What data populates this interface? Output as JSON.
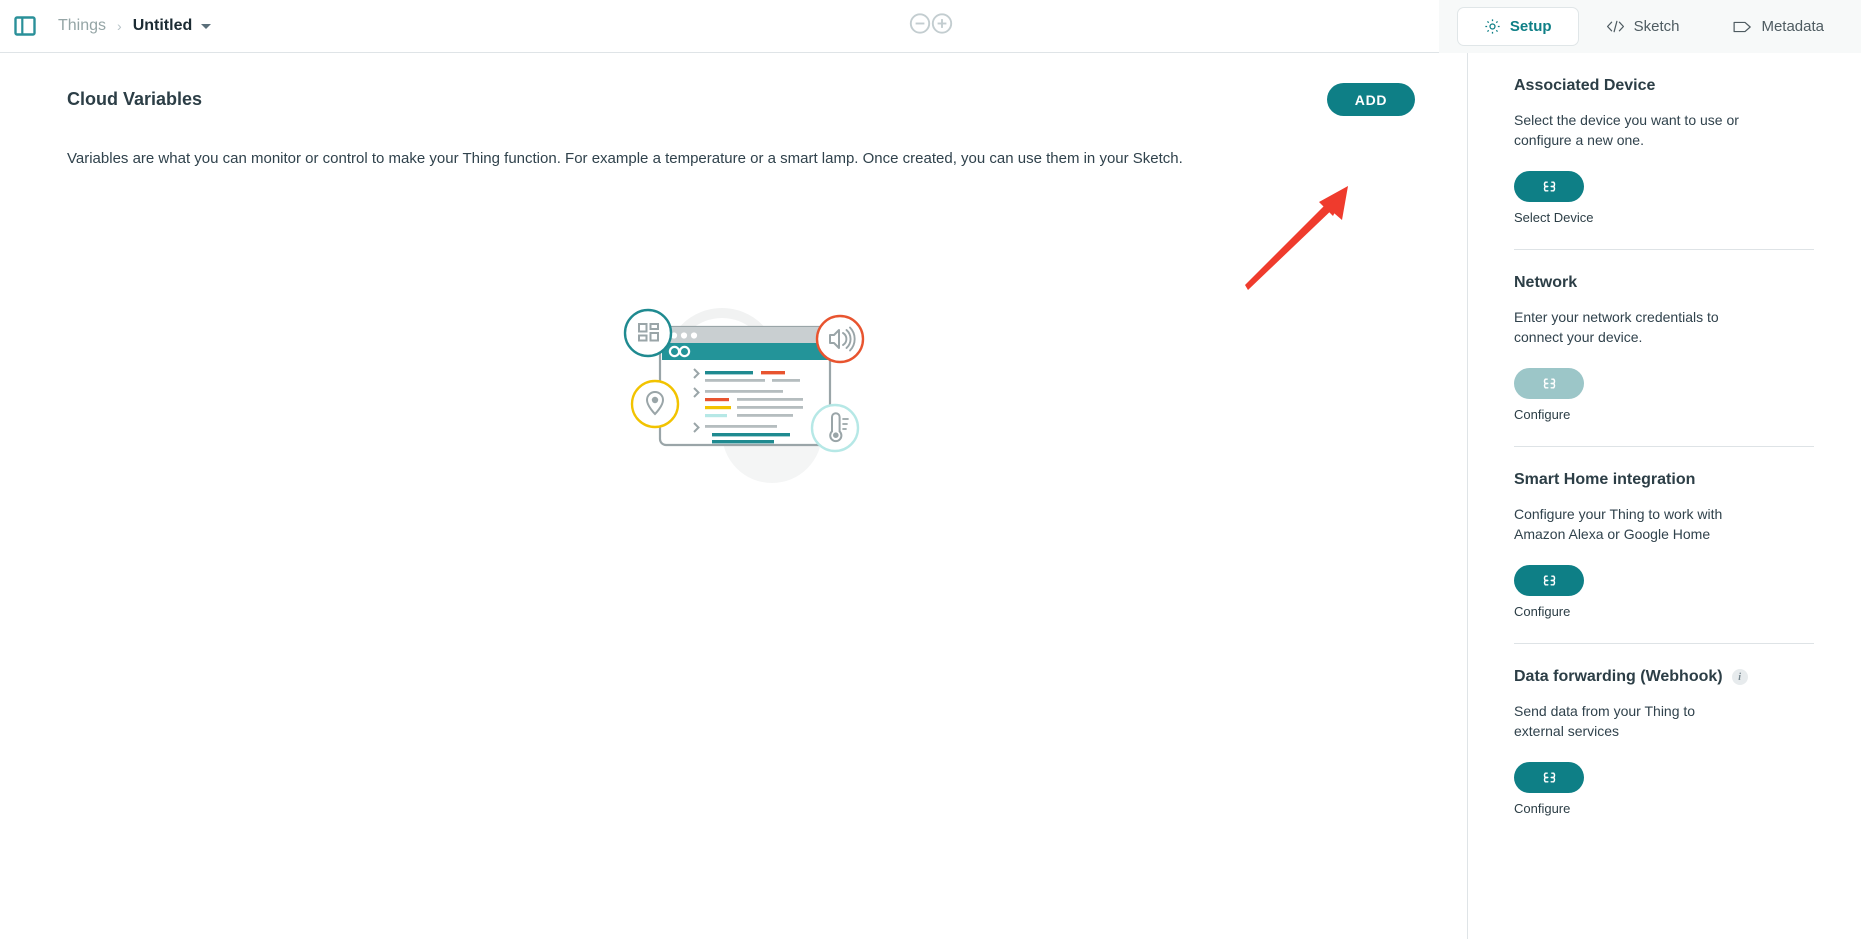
{
  "topbar": {
    "panel_toggle_icon": "sidebar-panel-icon",
    "breadcrumb": {
      "root": "Things",
      "separator": "›",
      "current": "Untitled"
    },
    "logo_icon": "arduino-infinity-logo",
    "tabs": [
      {
        "label": "Setup",
        "icon": "gear-icon",
        "active": true
      },
      {
        "label": "Sketch",
        "icon": "code-brackets-icon",
        "active": false
      },
      {
        "label": "Metadata",
        "icon": "tag-icon",
        "active": false
      }
    ]
  },
  "main": {
    "title": "Cloud Variables",
    "add_label": "ADD",
    "description": "Variables are what you can monitor or control to make your Thing function. For example a temperature or a smart lamp. Once created, you can use them in your Sketch.",
    "illustration": {
      "name": "cloud-variables-empty-state-illustration",
      "badges": [
        "dashboard-grid-icon",
        "speaker-volume-icon",
        "location-pin-icon",
        "thermometer-icon"
      ],
      "window_logo": "arduino-infinity-logo"
    },
    "annotation": {
      "name": "red-arrow-pointing-to-add-button",
      "color": "#ef3b2d"
    }
  },
  "sidebar": {
    "sections": [
      {
        "title": "Associated Device",
        "description": "Select the device you want to use or configure a new one.",
        "button_icon": "link-chain-icon",
        "button_label": "Select Device",
        "disabled": false
      },
      {
        "title": "Network",
        "description": "Enter your network credentials to connect your device.",
        "button_icon": "link-chain-icon",
        "button_label": "Configure",
        "disabled": true
      },
      {
        "title": "Smart Home integration",
        "description": "Configure your Thing to work with Amazon Alexa or Google Home",
        "button_icon": "link-chain-icon",
        "button_label": "Configure",
        "disabled": false
      },
      {
        "title": "Data forwarding (Webhook)",
        "info_badge": "i",
        "description": "Send data from your Thing to external services",
        "button_icon": "link-chain-icon",
        "button_label": "Configure",
        "disabled": false
      }
    ]
  },
  "colors": {
    "accent_teal": "#0e7f86",
    "accent_teal_disabled": "#9cc6c8",
    "annotation_red": "#ef3b2d",
    "text_dark": "#2c3e46",
    "text_muted": "#95a5a6",
    "border": "#dfe4e7",
    "tabbar_bg": "#f7f9f9",
    "illustration_orange": "#e8542f",
    "illustration_yellow": "#f2c300",
    "illustration_cyan": "#b6e8e6",
    "illustration_gray": "#9aa5a8"
  }
}
